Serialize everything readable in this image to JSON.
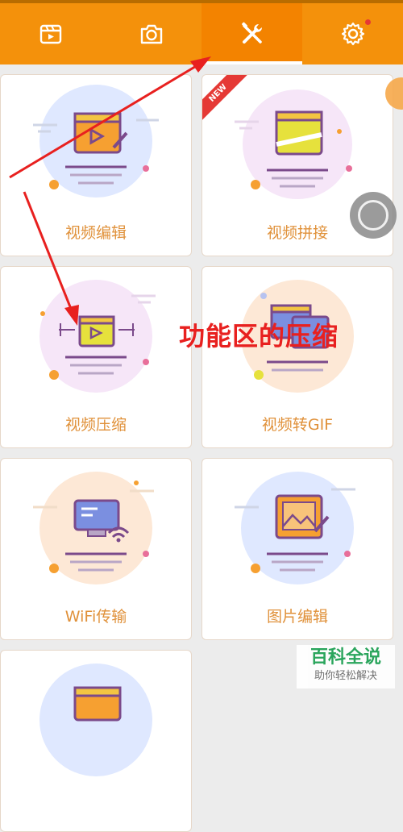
{
  "topbar": {
    "tabs": [
      {
        "name": "video-tab",
        "icon": "clapperboard-icon",
        "active": false
      },
      {
        "name": "camera-tab",
        "icon": "camera-icon",
        "active": false
      },
      {
        "name": "tools-tab",
        "icon": "tools-icon",
        "active": true
      },
      {
        "name": "settings-tab",
        "icon": "gear-icon",
        "active": false,
        "badge": "red-dot"
      }
    ],
    "color": "#f4910b"
  },
  "cards": [
    {
      "label": "视频编辑",
      "icon": "video-edit-icon",
      "bubble": "#dfe8ff"
    },
    {
      "label": "视频拼接",
      "icon": "video-merge-icon",
      "bubble": "#f6e6f8",
      "ribbon": "NEW"
    },
    {
      "label": "视频压缩",
      "icon": "video-compress-icon",
      "bubble": "#f6e6f8"
    },
    {
      "label": "视频转GIF",
      "icon": "video-to-gif-icon",
      "bubble": "#fde8d6"
    },
    {
      "label": "WiFi传输",
      "icon": "wifi-transfer-icon",
      "bubble": "#fde8d6"
    },
    {
      "label": "图片编辑",
      "icon": "image-edit-icon",
      "bubble": "#dfe8ff"
    },
    {
      "label": "",
      "icon": "video-icon",
      "bubble": "#dfe8ff"
    }
  ],
  "annotation": {
    "text": "功能区的压缩",
    "color": "#e8201f"
  },
  "watermark": {
    "line1": "百科全说",
    "line2": "助你轻松解决"
  },
  "colors": {
    "accent": "#f4910b",
    "label": "#e0913a",
    "annotation": "#e8201f"
  }
}
